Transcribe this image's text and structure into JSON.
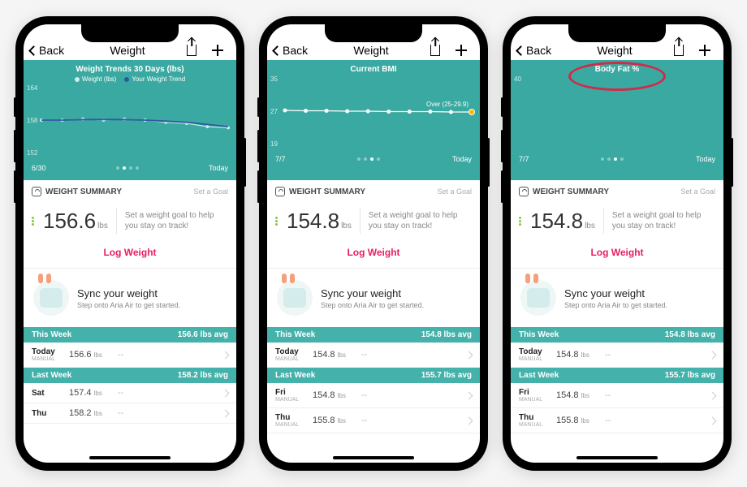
{
  "phones": [
    {
      "nav": {
        "back": "Back",
        "title": "Weight"
      },
      "chart": {
        "title": "Weight Trends 30 Days (lbs)",
        "legend": [
          {
            "label": "Weight (lbs)",
            "color": "#cdeeea"
          },
          {
            "label": "Your Weight Trend",
            "color": "#2c5aa0"
          }
        ],
        "yTicks": [
          "164",
          "158",
          "152"
        ],
        "xLeft": "6/30",
        "xRight": "Today",
        "activeDot": 1
      },
      "summary": {
        "header": "WEIGHT SUMMARY",
        "setGoal": "Set a Goal",
        "value": "156.6",
        "unit": "lbs",
        "hint": "Set a weight goal to help you stay on track!",
        "logBtn": "Log Weight"
      },
      "sync": {
        "title": "Sync your weight",
        "sub": "Step onto Aria Air to get started."
      },
      "weeks": [
        {
          "label": "This Week",
          "avg": "156.6 lbs avg",
          "rows": [
            {
              "day": "Today",
              "mode": "MANUAL",
              "val": "156.6",
              "unit": "lbs",
              "rest": "--"
            }
          ]
        },
        {
          "label": "Last Week",
          "avg": "158.2 lbs avg",
          "rows": [
            {
              "day": "Sat",
              "mode": "",
              "val": "157.4",
              "unit": "lbs",
              "rest": "--"
            },
            {
              "day": "Thu",
              "mode": "",
              "val": "158.2",
              "unit": "lbs",
              "rest": "--"
            }
          ]
        }
      ],
      "circled": false
    },
    {
      "nav": {
        "back": "Back",
        "title": "Weight"
      },
      "chart": {
        "title": "Current BMI",
        "legend": [],
        "yTicks": [
          "35",
          "27",
          "19"
        ],
        "xLeft": "7/7",
        "xRight": "Today",
        "activeDot": 2,
        "overLabel": "Over (25-29.9)"
      },
      "summary": {
        "header": "WEIGHT SUMMARY",
        "setGoal": "Set a Goal",
        "value": "154.8",
        "unit": "lbs",
        "hint": "Set a weight goal to help you stay on track!",
        "logBtn": "Log Weight"
      },
      "sync": {
        "title": "Sync your weight",
        "sub": "Step onto Aria Air to get started."
      },
      "weeks": [
        {
          "label": "This Week",
          "avg": "154.8 lbs avg",
          "rows": [
            {
              "day": "Today",
              "mode": "MANUAL",
              "val": "154.8",
              "unit": "lbs",
              "rest": "--"
            }
          ]
        },
        {
          "label": "Last Week",
          "avg": "155.7 lbs avg",
          "rows": [
            {
              "day": "Fri",
              "mode": "MANUAL",
              "val": "154.8",
              "unit": "lbs",
              "rest": "--"
            },
            {
              "day": "Thu",
              "mode": "MANUAL",
              "val": "155.8",
              "unit": "lbs",
              "rest": "--"
            }
          ]
        }
      ],
      "circled": false
    },
    {
      "nav": {
        "back": "Back",
        "title": "Weight"
      },
      "chart": {
        "title": "Body Fat %",
        "legend": [],
        "yTicks": [
          "40",
          "",
          ""
        ],
        "xLeft": "7/7",
        "xRight": "Today",
        "activeDot": 2
      },
      "summary": {
        "header": "WEIGHT SUMMARY",
        "setGoal": "Set a Goal",
        "value": "154.8",
        "unit": "lbs",
        "hint": "Set a weight goal to help you stay on track!",
        "logBtn": "Log Weight"
      },
      "sync": {
        "title": "Sync your weight",
        "sub": "Step onto Aria Air to get started."
      },
      "weeks": [
        {
          "label": "This Week",
          "avg": "154.8 lbs avg",
          "rows": [
            {
              "day": "Today",
              "mode": "MANUAL",
              "val": "154.8",
              "unit": "lbs",
              "rest": "--"
            }
          ]
        },
        {
          "label": "Last Week",
          "avg": "155.7 lbs avg",
          "rows": [
            {
              "day": "Fri",
              "mode": "MANUAL",
              "val": "154.8",
              "unit": "lbs",
              "rest": "--"
            },
            {
              "day": "Thu",
              "mode": "MANUAL",
              "val": "155.8",
              "unit": "lbs",
              "rest": "--"
            }
          ]
        }
      ],
      "circled": true
    }
  ],
  "chart_data": [
    {
      "type": "line",
      "title": "Weight Trends 30 Days (lbs)",
      "xlabel": "",
      "ylabel": "lbs",
      "ylim": [
        152,
        164
      ],
      "x_range": [
        "6/30",
        "Today"
      ],
      "series": [
        {
          "name": "Weight (lbs)",
          "color": "#cdeeea",
          "values": [
            158,
            158,
            158.2,
            158,
            158.2,
            158,
            157.6,
            157.4,
            156.8,
            156.6
          ]
        },
        {
          "name": "Your Weight Trend",
          "color": "#2c5aa0",
          "values": [
            158,
            158,
            158.1,
            158.1,
            158.1,
            158,
            157.8,
            157.6,
            157.2,
            156.8
          ]
        }
      ]
    },
    {
      "type": "line",
      "title": "Current BMI",
      "xlabel": "",
      "ylabel": "BMI",
      "ylim": [
        19,
        35
      ],
      "x_range": [
        "7/7",
        "Today"
      ],
      "annotation": "Over (25-29.9)",
      "series": [
        {
          "name": "BMI",
          "color": "#ffffff",
          "values": [
            27.2,
            27.1,
            27.1,
            27.0,
            27.0,
            26.9,
            26.9,
            26.9,
            26.8,
            26.8
          ]
        }
      ],
      "highlight_last": true
    },
    {
      "type": "line",
      "title": "Body Fat %",
      "xlabel": "",
      "ylabel": "%",
      "ylim": [
        0,
        40
      ],
      "x_range": [
        "7/7",
        "Today"
      ],
      "series": [
        {
          "name": "Body Fat %",
          "values": []
        }
      ]
    }
  ]
}
